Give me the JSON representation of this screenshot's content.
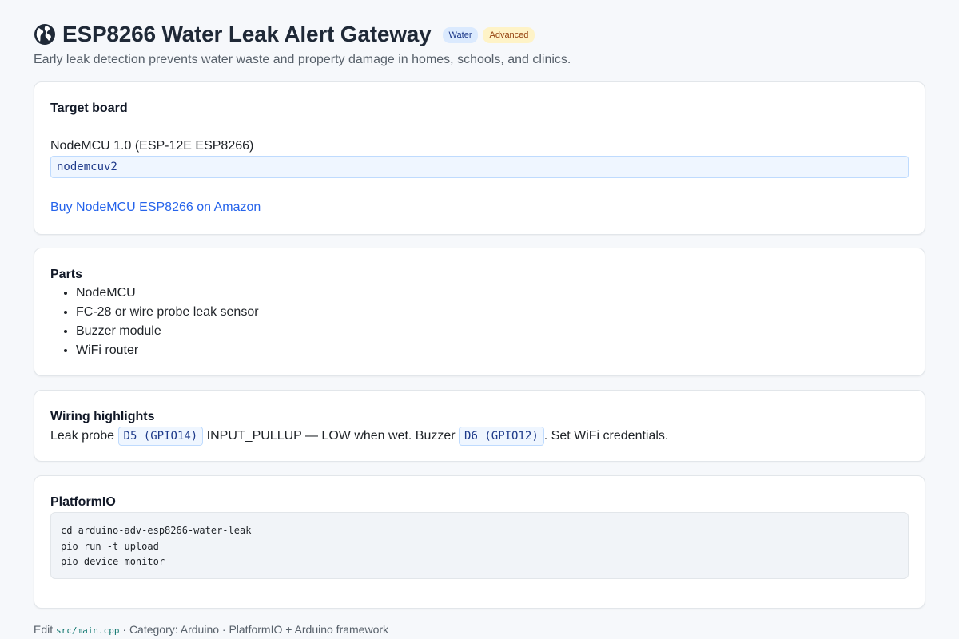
{
  "header": {
    "title": "ESP8266 Water Leak Alert Gateway",
    "badges": {
      "category": "Water",
      "level": "Advanced"
    },
    "subtitle": "Early leak detection prevents water waste and property damage in homes, schools, and clinics.",
    "icon": "globe-icon"
  },
  "board": {
    "heading": "Target board",
    "name": "NodeMCU 1.0 (ESP-12E ESP8266)",
    "id": "nodemcuv2",
    "buy_link": "Buy NodeMCU ESP8266 on Amazon"
  },
  "parts": {
    "heading": "Parts",
    "items": [
      "NodeMCU",
      "FC-28 or wire probe leak sensor",
      "Buzzer module",
      "WiFi router"
    ]
  },
  "wiring": {
    "heading": "Wiring highlights",
    "text_1": "Leak probe ",
    "pin_1": "D5 (GPIO14)",
    "text_2": " INPUT_PULLUP — LOW when wet. Buzzer ",
    "pin_2": "D6 (GPIO12)",
    "text_3": ". Set WiFi credentials."
  },
  "platformio": {
    "heading": "PlatformIO",
    "commands": [
      "cd arduino-adv-esp8266-water-leak",
      "pio run -t upload",
      "pio device monitor"
    ]
  },
  "footer": {
    "prefix": "Edit ",
    "file": "src/main.cpp",
    "suffix": " · Category: Arduino · PlatformIO + Arduino framework"
  },
  "colors": {
    "accent": "#2563eb",
    "badge_water_bg": "#dbeafe",
    "badge_level_bg": "#fef3c7",
    "page_bg": "#f6f8fb"
  }
}
